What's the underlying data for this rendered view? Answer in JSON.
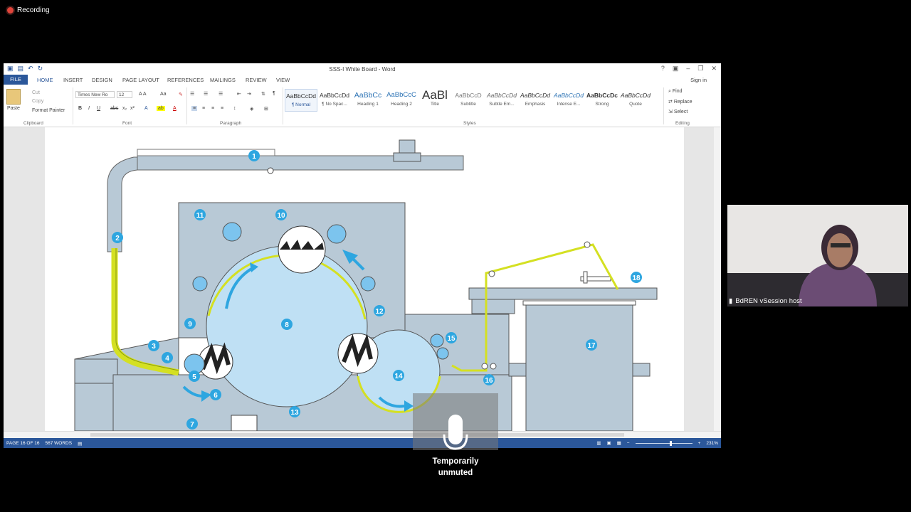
{
  "recording": {
    "label": "Recording"
  },
  "word": {
    "title": "SSS-I White Board - Word",
    "winbtns": [
      "?",
      "▣",
      "–",
      "❐",
      "✕"
    ],
    "tabs": [
      "FILE",
      "HOME",
      "INSERT",
      "DESIGN",
      "PAGE LAYOUT",
      "REFERENCES",
      "MAILINGS",
      "REVIEW",
      "VIEW"
    ],
    "signin": "Sign in",
    "clipboard": {
      "paste": "Paste",
      "cut": "Cut",
      "copy": "Copy",
      "format_painter": "Format Painter",
      "group": "Clipboard"
    },
    "font": {
      "name": "Times New Ro",
      "size": "12",
      "group": "Font"
    },
    "paragraph": {
      "group": "Paragraph"
    },
    "styles": {
      "group": "Styles",
      "items": [
        {
          "sample": "AaBbCcDd",
          "name": "¶ Normal"
        },
        {
          "sample": "AaBbCcDd",
          "name": "¶ No Spac..."
        },
        {
          "sample": "AaBbCc",
          "name": "Heading 1"
        },
        {
          "sample": "AaBbCcC",
          "name": "Heading 2"
        },
        {
          "sample": "AaBl",
          "name": "Title"
        },
        {
          "sample": "AaBbCcD",
          "name": "Subtitle"
        },
        {
          "sample": "AaBbCcDd",
          "name": "Subtle Em..."
        },
        {
          "sample": "AaBbCcDd",
          "name": "Emphasis"
        },
        {
          "sample": "AaBbCcDd",
          "name": "Intense E..."
        },
        {
          "sample": "AaBbCcDc",
          "name": "Strong"
        },
        {
          "sample": "AaBbCcDd",
          "name": "Quote"
        }
      ]
    },
    "editing": {
      "find": "Find",
      "replace": "Replace",
      "select": "Select",
      "group": "Editing"
    },
    "status": {
      "page": "PAGE 16 OF 16",
      "words": "567 WORDS",
      "zoom": "231%"
    }
  },
  "diagram": {
    "labels": [
      "1",
      "2",
      "3",
      "4",
      "5",
      "6",
      "7",
      "8",
      "9",
      "10",
      "11",
      "12",
      "13",
      "14",
      "15",
      "16",
      "17",
      "18"
    ]
  },
  "participant": {
    "name": "BdREN vSession host"
  },
  "mic": {
    "line1": "Temporarily",
    "line2": "unmuted"
  },
  "colors": {
    "word_blue": "#2b579a",
    "machine_gray": "#b8c9d6",
    "drum_blue": "#bfe0f4",
    "label_blue": "#2ea6e0",
    "web_yellow": "#d4e022"
  }
}
